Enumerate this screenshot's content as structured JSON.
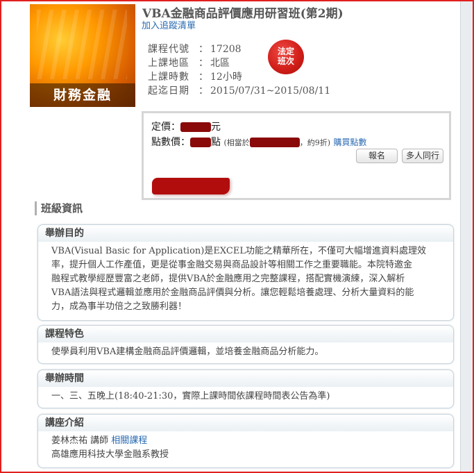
{
  "course": {
    "category": "財務金融",
    "title": "VBA金融商品評價應用研習班(第2期)",
    "follow_label": "加入追蹤清單",
    "seal_text": "法定班次",
    "info": [
      {
        "label": "課程代號",
        "colon": "：",
        "value": "17208"
      },
      {
        "label": "上課地區",
        "colon": "：",
        "value": "北區"
      },
      {
        "label": "上課時數",
        "colon": "：",
        "value": "12小時"
      },
      {
        "label": "起迄日期",
        "colon": "：",
        "value": "2015/07/31~2015/08/11"
      }
    ]
  },
  "pricing": {
    "list_price_label": "定價：",
    "list_price_unit": "元",
    "points_label": "點數價：",
    "points_unit": "點",
    "equivalent_prefix": "(相當於",
    "discount_text": "，約9折)",
    "buy_points_link": "購買點數",
    "register_button": "報名",
    "group_button": "多人同行"
  },
  "class_info": {
    "heading": "班級資訊",
    "sections": [
      {
        "title": "舉辦目的",
        "lines": [
          "VBA(Visual Basic for Application)是EXCEL功能之精華所在，不僅可大幅增進資料處理效",
          "率，提升個人工作產值，更是從事金融交易與商品設計等相關工作之重要職能。本院特邀金",
          "融程式教學經歷豐富之老師，提供VBA於金融應用之完整課程，搭配實機演練，深入解析",
          "VBA語法與程式邏輯並應用於金融商品評價與分析。讓您輕鬆培養處理、分析大量資料的能",
          "力，成為事半功倍之之致勝利器！"
        ]
      },
      {
        "title": "課程特色",
        "lines": [
          "使學員利用VBA建構金融商品評價邏輯，並培養金融商品分析能力。"
        ]
      },
      {
        "title": "舉辦時間",
        "lines": [
          "一、三、五晚上(18:40-21:30，實際上課時間依課程時間表公告為準)"
        ]
      },
      {
        "title": "講座介紹",
        "instructor": "姜林杰祐 講師",
        "related_link": "相關課程",
        "affiliation": "高雄應用科技大學金融系教授"
      }
    ]
  }
}
